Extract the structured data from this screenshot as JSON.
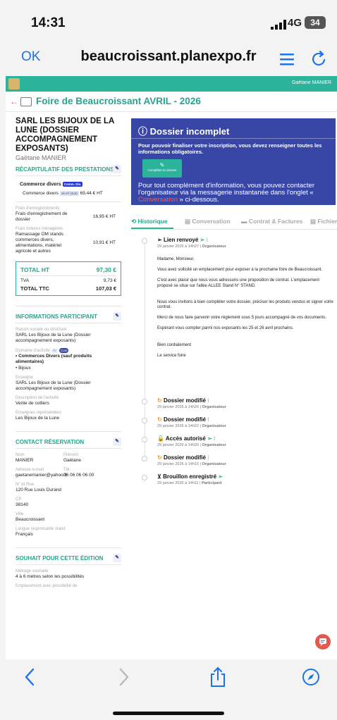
{
  "status": {
    "time": "14:31",
    "network": "4G",
    "battery": "34"
  },
  "browser": {
    "ok_label": "OK",
    "url": "beaucroissant.planexpo.fr"
  },
  "topbar": {
    "user": "Gaëtane MANIER"
  },
  "event": {
    "title": "Foire de Beaucroissant AVRIL - 2026"
  },
  "exhibitor": {
    "company": "SARL LES BIJOUX DE LA LUNE (DOSSIER ACCOMPAGNEMENT EXPOSANTS)",
    "person": "Gaëtane MANIER"
  },
  "recap": {
    "title": "RÉCAPITULATIF DES PRESTATIONS",
    "sector": "Commerce divers",
    "sector_badge": "Comm. Div.",
    "line_label": "Commerce divers",
    "line_badge": "16 m² (4x4)",
    "line_price": "69,44 € HT",
    "fees_label": "Frais d'enregistrements",
    "fees_item": "Frais d'enregistrement de dossier",
    "fees_price": "16,95 € HT",
    "waste_label": "Frais ordures ménagères",
    "waste_item": "Ramassage OM stands commerces divers, alimentations, matériel agricole et autres",
    "waste_price": "10,91 € HT",
    "total_ht_label": "TOTAL HT",
    "total_ht": "97,30 €",
    "tva_label": "TVA",
    "tva": "9,73 €",
    "total_ttc_label": "TOTAL TTC",
    "total_ttc": "107,03 €"
  },
  "participant": {
    "title": "INFORMATIONS PARTICIPANT",
    "raison_label": "Raison sociale ou structure",
    "raison": "SARL Les Bijoux de la Lune (Dossier accompagnement exposants)",
    "domaine_label": "Domaine d'activité",
    "domaine_badge1": "AV",
    "domaine_badge2": "Com",
    "domaine1": "• Commerces Divers (sauf produits alimentaires)",
    "domaine2": "• Bijoux",
    "enseigne_label": "Enseigne",
    "enseigne": "SARL Les Bijoux de la Lune (Dossier accompagnement exposants)",
    "desc_label": "Description de l'activité",
    "desc": "Vente de colliers",
    "rep_label": "Enseignes représentées",
    "rep": "Les Bijoux de la Lune"
  },
  "contact": {
    "title": "CONTACT RÉSERVATION",
    "nom_label": "Nom",
    "nom": "MANIER",
    "prenom_label": "Prénom",
    "prenom": "Gaëtane",
    "email_label": "Adresse e-mail",
    "email": "gaetanemanier@yahoo.fr",
    "tel_label": "Tél.",
    "tel": "06 06 06 06 00",
    "rue_label": "N° et Rue",
    "rue": "120 Rue Louis Durand",
    "cp_label": "CP",
    "cp": "38140",
    "ville_label": "Ville",
    "ville": "Beaucroissant",
    "langue_label": "Langue responsable stand",
    "langue": "Français"
  },
  "souhait": {
    "title": "SOUHAIT POUR CETTE ÉDITION",
    "metrage_label": "Métrage souhaité",
    "metrage": "4 à 6 mètres selon les possibilités",
    "emplacement_label": "Emplacement avec possibilité de"
  },
  "banner": {
    "title": "Dossier incomplet",
    "subtitle": "Pour pouvoir finaliser votre inscription, vous devez renseigner toutes les informations obligatoires.",
    "button": "Compléter le dossier",
    "info_before": "Pour tout complément d'information, vous pouvez contacter l'organisateur via la messagerie instantanée dans l'onglet « ",
    "info_link": "Conversation",
    "info_after": " » ci-dessous."
  },
  "tabs": [
    {
      "label": "Historique"
    },
    {
      "label": "Conversation"
    },
    {
      "label": "Contrat & Factures"
    },
    {
      "label": "Fichiers"
    }
  ],
  "history": [
    {
      "title": "Lien renvoyé",
      "date": "29 janvier 2026 à 14h27",
      "actor": "Organisateur"
    },
    {
      "title": "Dossier modifié",
      "date": "29 janvier 2026 à 14h26",
      "actor": "Organisateur"
    },
    {
      "title": "Dossier modifié",
      "date": "29 janvier 2026 à 14h22",
      "actor": "Organisateur"
    },
    {
      "title": "Accès autorisé",
      "date": "29 janvier 2026 à 14h20",
      "actor": "Organisateur"
    },
    {
      "title": "Dossier modifié",
      "date": "29 janvier 2026 à 14h15",
      "actor": "Organisateur"
    },
    {
      "title": "Brouillon enregistré",
      "date": "29 janvier 2026 à 14h11",
      "actor": "Participant"
    }
  ],
  "message": {
    "p1": "Madame, Monsieur,",
    "p2": "Vous avez sollicité un emplacement pour exposer à la prochaine foire de Beaucroissant.",
    "p3": "C'est avec plaisir que nous vous adressons une proposition de contrat. L'emplacement proposé se situe sur l'allée ALLEE Stand N° STAND.",
    "p4": "Nous vous invitons à bien compléter votre dossier, préciser les produits vendus et signer votre contrat.",
    "p5": "Merci de nous faire parvenir votre règlement sous 5 jours accompagné de vos documents.",
    "p6": "Espérant vous compter parmi nos exposants les 25 et 26 avril prochains.",
    "p7": "Bien cordialement",
    "p8": "Le service foire"
  },
  "colors": {
    "accent": "#2bb39b",
    "banner": "#3847a6",
    "danger": "#e05a4f",
    "link": "#1a73e8"
  }
}
